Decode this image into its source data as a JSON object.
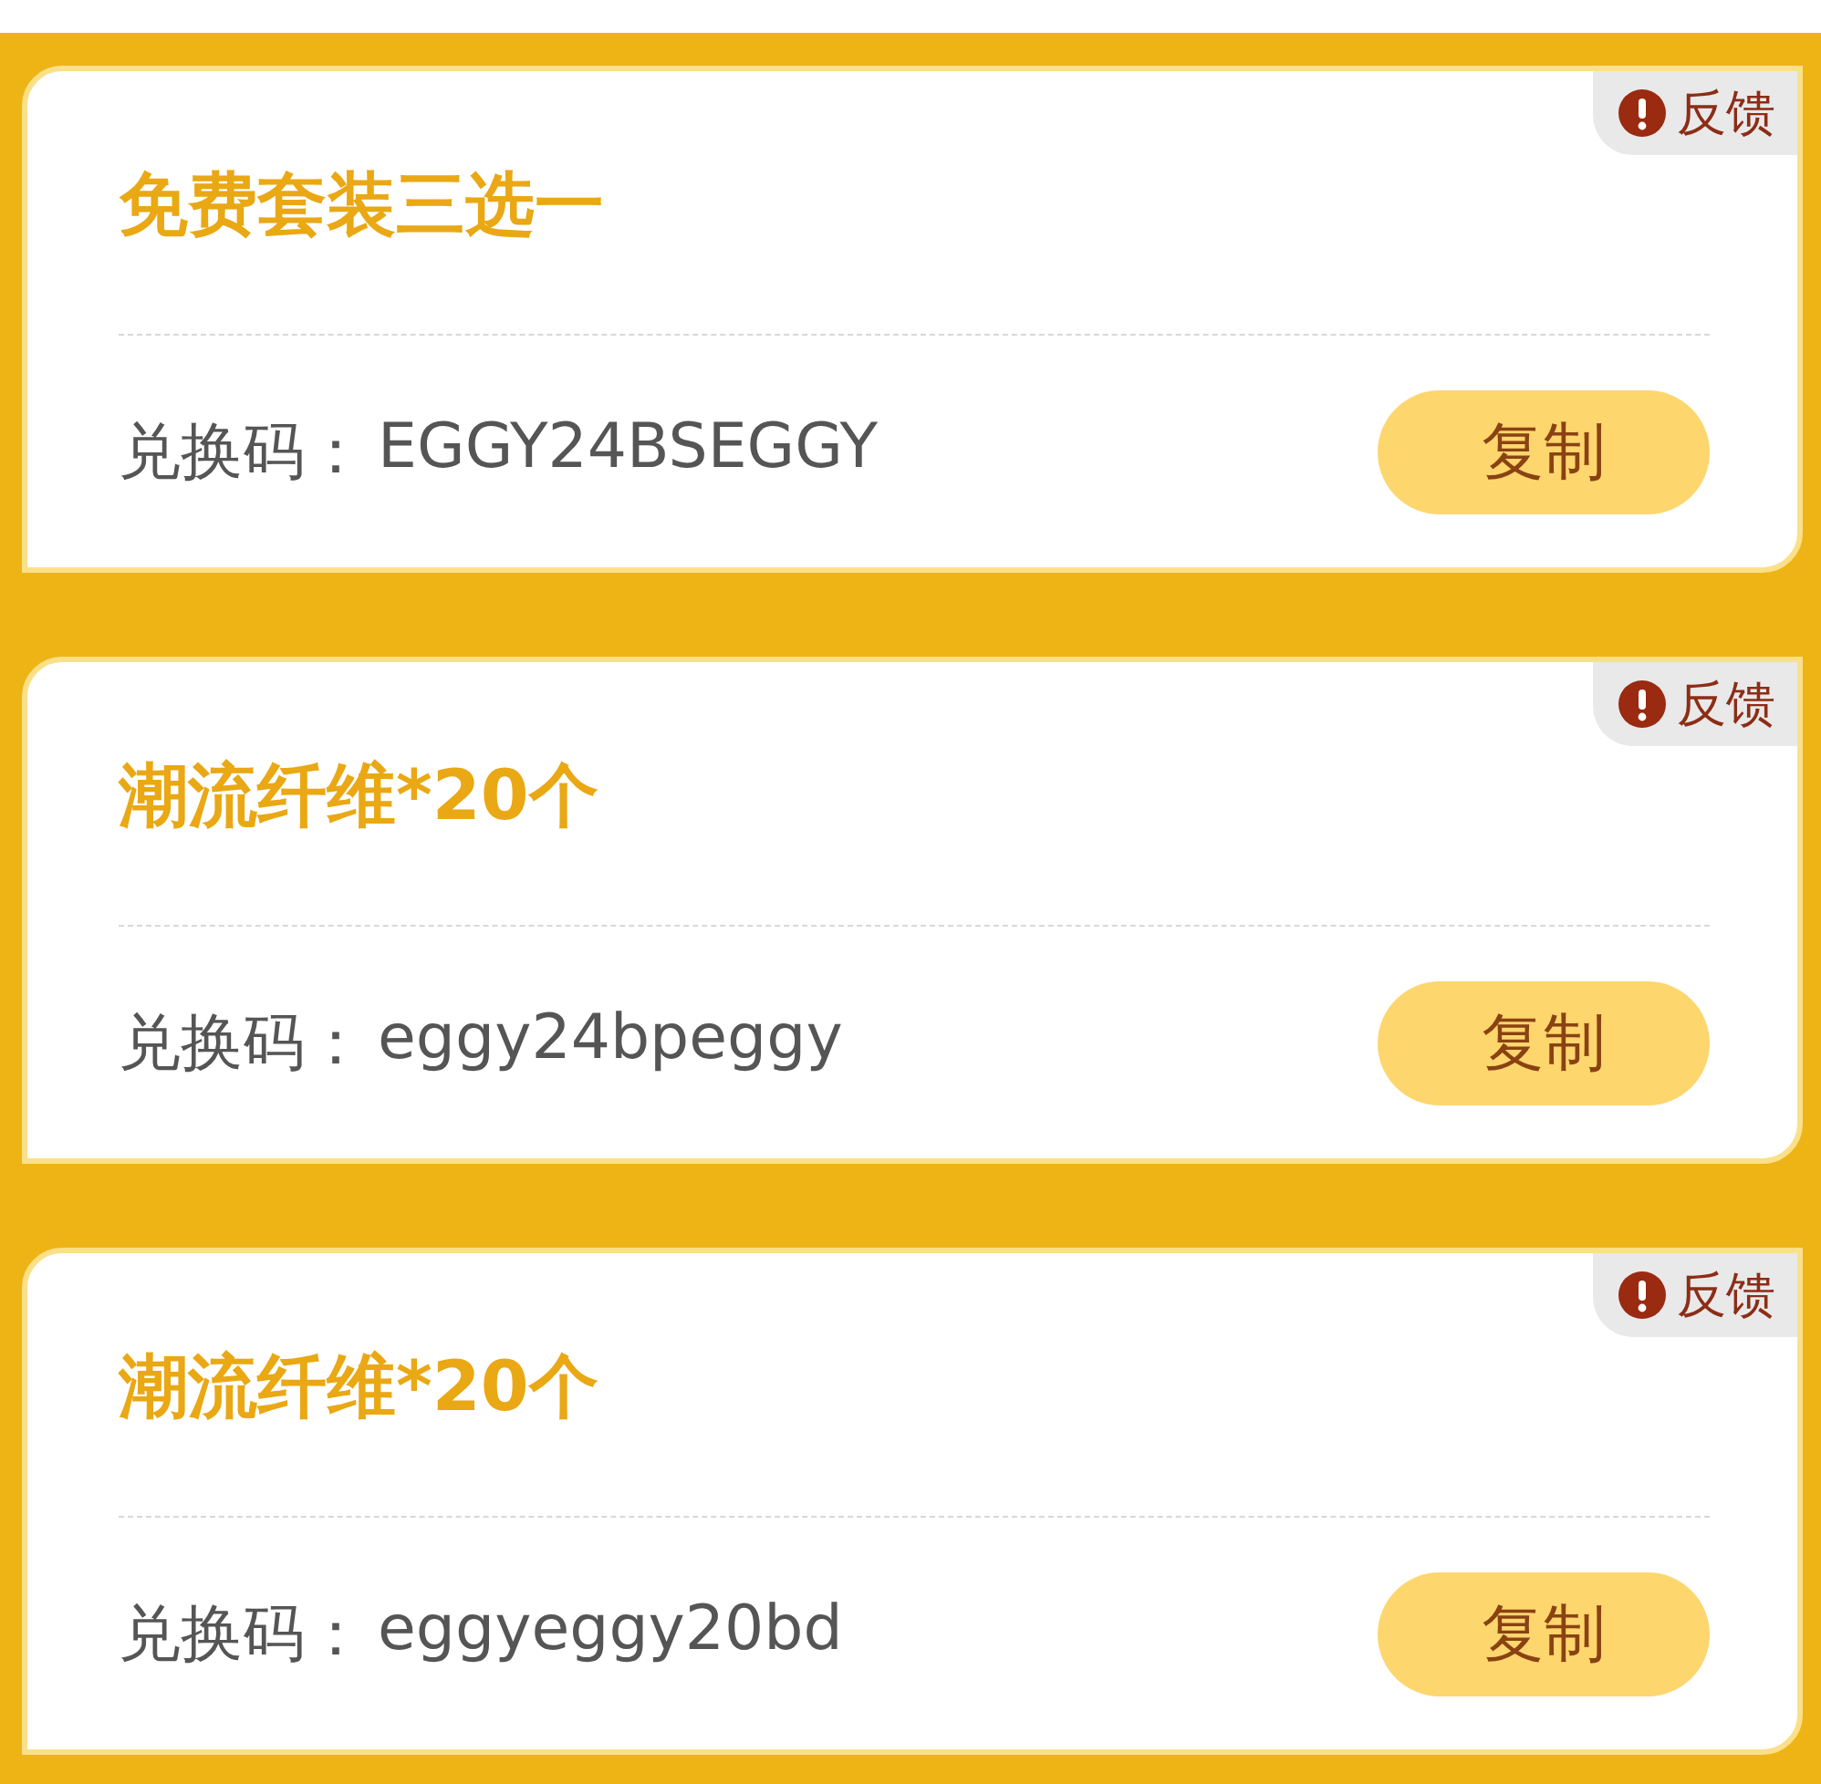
{
  "cards": [
    {
      "title": "免费套装三选一",
      "feedback": "反馈",
      "code_label": "兑换码：",
      "code": "EGGY24BSEGGY",
      "button": "复制"
    },
    {
      "title": "潮流纤维*20个",
      "feedback": "反馈",
      "code_label": "兑换码：",
      "code": "eggy24bpeggy",
      "button": "复制"
    },
    {
      "title": "潮流纤维*20个",
      "feedback": "反馈",
      "code_label": "兑换码：",
      "code": "eggyeggy20bd",
      "button": "复制"
    }
  ]
}
